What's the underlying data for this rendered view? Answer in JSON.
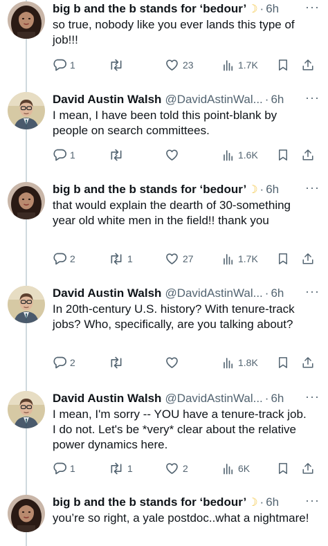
{
  "tweets": [
    {
      "name": "big b and the b stands for ‘bedour’",
      "emoji": "☽",
      "handle": "",
      "time": "6h",
      "text": "so true, nobody like you ever lands this type of job!!!",
      "replies": "1",
      "retweets": "",
      "likes": "23",
      "views": "1.7K",
      "avatar": "woman"
    },
    {
      "name": "David Austin Walsh",
      "emoji": "",
      "handle": "@DavidAstinWal...",
      "time": "6h",
      "text": "I mean, I have been told this point-blank by people on search committees.",
      "replies": "1",
      "retweets": "",
      "likes": "",
      "views": "1.6K",
      "avatar": "man"
    },
    {
      "name": "big b and the b stands for ‘bedour’",
      "emoji": "☽",
      "handle": "",
      "time": "6h",
      "text": "that would explain the dearth of  30-something year old white men in the field!! thank you",
      "replies": "2",
      "retweets": "1",
      "likes": "27",
      "views": "1.7K",
      "avatar": "woman"
    },
    {
      "name": "David Austin Walsh",
      "emoji": "",
      "handle": "@DavidAstinWal...",
      "time": "6h",
      "text": "In 20th-century U.S. history? With tenure-track jobs? Who, specifically, are you talking about?",
      "replies": "2",
      "retweets": "",
      "likes": "",
      "views": "1.8K",
      "avatar": "man"
    },
    {
      "name": "David Austin Walsh",
      "emoji": "",
      "handle": "@DavidAstinWal...",
      "time": "6h",
      "text": "I mean, I'm sorry -- YOU have a tenure-track job. I do not. Let's be *very* clear about the relative power dynamics here.",
      "replies": "1",
      "retweets": "1",
      "likes": "2",
      "views": "6K",
      "avatar": "man"
    },
    {
      "name": "big b and the b stands for ‘bedour’",
      "emoji": "☽",
      "handle": "",
      "time": "6h",
      "text": "you’re so right, a yale postdoc..what a nightmare!",
      "replies": "",
      "retweets": "",
      "likes": "",
      "views": "",
      "avatar": "woman"
    }
  ],
  "icons": {
    "reply": "speech-bubble-icon",
    "retweet": "retweet-arrows-icon",
    "like": "heart-icon",
    "views": "bar-chart-icon",
    "bookmark": "bookmark-icon",
    "share": "share-upload-icon",
    "more": "more-dots-icon"
  },
  "colors": {
    "text": "#0f1419",
    "secondary": "#536471",
    "thread_line": "#cfd9de",
    "moon": "#f3c645"
  }
}
